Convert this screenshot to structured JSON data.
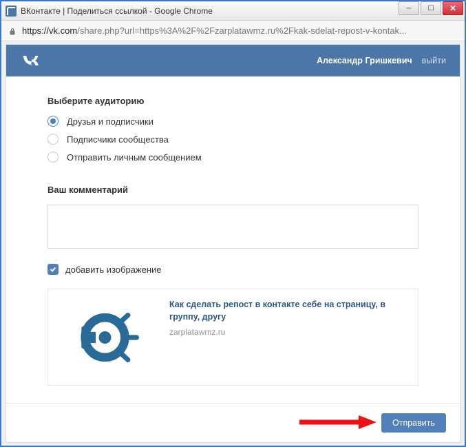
{
  "window": {
    "title": "ВКонтакте | Поделиться ссылкой - Google Chrome"
  },
  "addressbar": {
    "host": "https://vk.com",
    "path": "/share.php?url=https%3A%2F%2Fzarplatawmz.ru%2Fkak-sdelat-repost-v-kontak..."
  },
  "vk": {
    "username": "Александр Гришкевич",
    "logout": "выйти",
    "audience_label": "Выберите аудиторию",
    "radios": [
      {
        "label": "Друзья и подписчики",
        "checked": true
      },
      {
        "label": "Подписчики сообщества",
        "checked": false
      },
      {
        "label": "Отправить личным сообщением",
        "checked": false
      }
    ],
    "comment_label": "Ваш комментарий",
    "comment_value": "",
    "add_image_label": "добавить изображение",
    "add_image_checked": true,
    "preview": {
      "title": "Как сделать репост в контакте себе на страницу, в группу, другу",
      "domain": "zarplatawmz.ru"
    },
    "submit": "Отправить"
  },
  "colors": {
    "vk_blue": "#4a76a8",
    "vk_accent": "#5181b8",
    "arrow": "#e11"
  }
}
